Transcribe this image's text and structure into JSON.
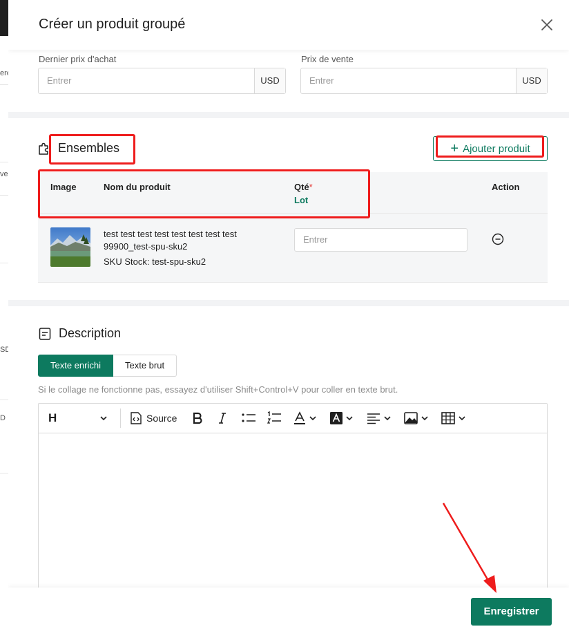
{
  "modal": {
    "title": "Créer un produit groupé"
  },
  "pricing": {
    "last_purchase_price_label": "Dernier prix d'achat",
    "last_purchase_price_placeholder": "Entrer",
    "last_purchase_currency": "USD",
    "sale_price_label": "Prix de vente",
    "sale_price_placeholder": "Entrer",
    "sale_currency": "USD"
  },
  "bundles": {
    "title": "Ensembles",
    "add_button_label": "Ajouter produit",
    "columns": {
      "image": "Image",
      "product_name": "Nom du produit",
      "qty": "Qté",
      "qty_required": "*",
      "qty_unit": "Lot",
      "action": "Action"
    },
    "rows": [
      {
        "name": "test test test test test test test test 99900_test-spu-sku2",
        "sku": "SKU Stock: test-spu-sku2",
        "qty_placeholder": "Entrer"
      }
    ]
  },
  "description": {
    "title": "Description",
    "tab_rich": "Texte enrichi",
    "tab_plain": "Texte brut",
    "hint": "Si le collage ne fonctionne pas, essayez d'utiliser Shift+Control+V pour coller en texte brut.",
    "toolbar": {
      "heading": "H",
      "source": "Source"
    }
  },
  "footer": {
    "save_label": "Enregistrer"
  },
  "background_fragments": [
    "ere",
    "ve",
    "SD",
    "D"
  ],
  "colors": {
    "accent": "#0d7a5f",
    "annotation": "#ee1c1c",
    "required": "#e53935"
  },
  "icons": [
    "close-icon",
    "puzzle-icon",
    "plus-icon",
    "minus-circle-icon",
    "document-icon",
    "chevron-down-icon",
    "source-code-icon",
    "bold-icon",
    "italic-icon",
    "bulleted-list-icon",
    "numbered-list-icon",
    "font-color-icon",
    "highlight-icon",
    "align-icon",
    "image-icon",
    "table-icon"
  ]
}
